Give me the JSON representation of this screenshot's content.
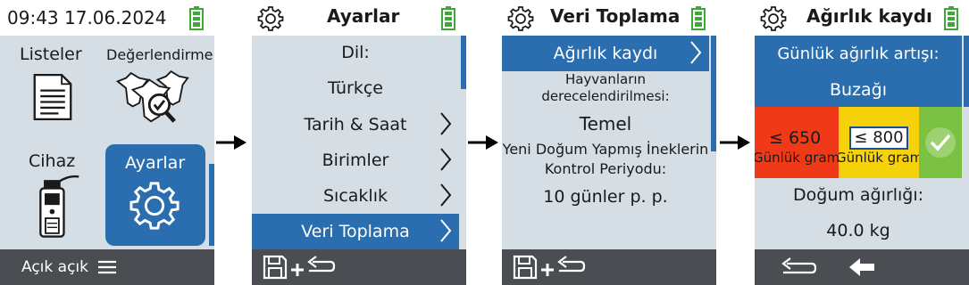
{
  "screen1": {
    "time": "09:43 17.06.2024",
    "tiles": {
      "listeler": "Listeler",
      "degerlendirme": "Değerlendirme",
      "cihaz": "Cihaz",
      "ayarlar": "Ayarlar"
    },
    "footer_text": "Açık açık"
  },
  "screen2": {
    "title": "Ayarlar",
    "items": [
      {
        "label": "Dil:"
      },
      {
        "label": "Türkçe"
      },
      {
        "label": "Tarih & Saat"
      },
      {
        "label": "Birimler"
      },
      {
        "label": "Sıcaklık"
      },
      {
        "label": "Veri Toplama"
      }
    ]
  },
  "screen3": {
    "title": "Veri Toplama",
    "items": [
      {
        "label": "Ağırlık kaydı"
      },
      {
        "label_line1": "Hayvanların",
        "label_line2": "derecelendirilmesi:"
      },
      {
        "label": "Temel"
      },
      {
        "label_line1": "Yeni Doğum Yapmış İneklerin",
        "label_line2": "Kontrol Periyodu:"
      },
      {
        "label": "10 günler p. p."
      }
    ]
  },
  "screen4": {
    "title": "Ağırlık kaydı",
    "gain_title": "Günlük ağırlık artışı:",
    "animal": "Buzağı",
    "thresholds": [
      {
        "label": "≤ 650",
        "sub": "Günlük gram",
        "color": "#f03a17"
      },
      {
        "label": "≤ 800",
        "sub": "Günlük gram",
        "color": "#f5d20a"
      },
      {
        "label": "",
        "sub": "",
        "color": "#7cc242"
      }
    ],
    "birth_weight_label": "Doğum ağırlığı:",
    "birth_weight_value": "40.0 kg"
  },
  "colors": {
    "accent": "#2a6eb0",
    "screen_bg": "#d6dee5",
    "footer": "#4a4d52",
    "battery": "#3aaa35"
  },
  "icons": {
    "settings": "gear-icon",
    "battery": "battery-icon",
    "chevron": "chevron-right-icon",
    "save": "save-icon",
    "back": "back-arrow-icon",
    "menu": "hamburger-menu-icon",
    "check": "checkmark-icon",
    "flow": "flow-arrow-icon"
  }
}
